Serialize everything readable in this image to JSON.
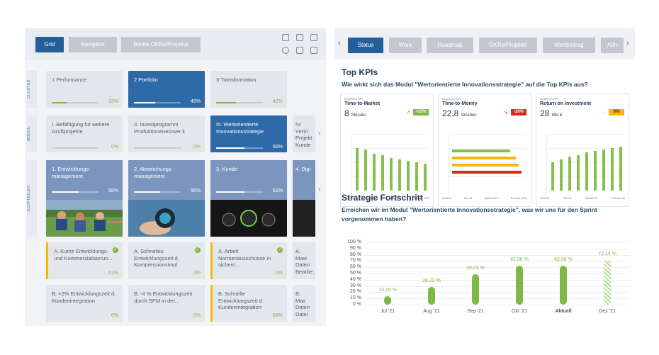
{
  "left": {
    "tabs": [
      "Grid",
      "Navigator",
      "Meine OKRs/Projekte"
    ],
    "side_labels": [
      "CLUSTER",
      "MODUL",
      "ECKPFEILER"
    ],
    "cluster": [
      {
        "title": "1 Performance",
        "pct": "33%",
        "progress": 0.33
      },
      {
        "title": "2 Portfolio",
        "pct": "45%",
        "progress": 0.45
      },
      {
        "title": "3 Transformation",
        "pct": "42%",
        "progress": 0.42
      }
    ],
    "modul": [
      {
        "title": "I. Befähigung für weitere Großprojekte",
        "pct": "0%",
        "progress": 0
      },
      {
        "title": "II. Investprogramm Produktionenetzwer k",
        "pct": "0%",
        "progress": 0
      },
      {
        "title": "III. Wertorientierte Innovationsstrategie",
        "pct": "60%",
        "progress": 0.6
      },
      {
        "title": "IV. Vertri Projekt Kunde"
      }
    ],
    "eckpfeiler": [
      {
        "title": "1. Entwicklungs- management",
        "pct": "58%",
        "progress": 0.58
      },
      {
        "title": "2. Abweichungs- management",
        "pct": "56%",
        "progress": 0.56
      },
      {
        "title": "3. Kunde",
        "pct": "61%",
        "progress": 0.61
      },
      {
        "title": "4. Digi"
      }
    ],
    "okr_row1": [
      {
        "title": "A. Kurze Entwicklungs- und Kommerzialisierun...",
        "pct": "61%"
      },
      {
        "title": "A. Schnelles Entwicklungszeit d. Kompressionsimul",
        "pct": "0%"
      },
      {
        "title": "A. Arbeit Normenausschüsse in sichern...",
        "pct": "0%"
      },
      {
        "title": "A. Maxi Daten Bearbe..."
      }
    ],
    "okr_row2": [
      {
        "title": "B. +2% Entwicklungszeit d. Kundenintegration",
        "pct": "0%"
      },
      {
        "title": "B. -4 % Entwicklungszeit durch SPM in der...",
        "pct": "0%"
      },
      {
        "title": "B. Schnelle Entwicklungszeit d. Kundenintegration",
        "pct": "68%"
      },
      {
        "title": "B. Max Daten Datei"
      }
    ]
  },
  "right": {
    "tabs": [
      "Status",
      "Work",
      "Roadmap",
      "OKRs/Projekte",
      "Wertbeitrag",
      "Abh"
    ],
    "top_kpis_title": "Top KPIs",
    "top_kpis_question": "Wie wirkt sich das Modul \"Wertorientierte Innovationsstrategie\" auf die Top KPIs aus?",
    "kpis": [
      {
        "small": "Ergebnis KPI",
        "name": "Time-to-Market",
        "value": "8",
        "unit": "Monate",
        "delta": "+33%",
        "delta_color": "#7fb842",
        "footer": [
          "Start 10",
          "Ziel 8",
          "Aktuell 8",
          "Erreicht 33%"
        ]
      },
      {
        "small": "Ergebnis KPI",
        "name": "Time-to-Money",
        "value": "22,8",
        "unit": "Wochen",
        "delta": "-20%",
        "delta_color": "#e02424",
        "footer": [
          "Start 24",
          "Ziel 18",
          "Aktuell 22,8",
          "Erreicht -20%"
        ]
      },
      {
        "small": "Ergebnis KPI",
        "name": "Return on Investment",
        "value": "28",
        "unit": "Mio €",
        "delta": "0%",
        "delta_color": "#f5b800",
        "footer": [
          "Start 24",
          "Ziel 30",
          "Aktuell 28",
          "Erreicht 0%"
        ]
      }
    ],
    "progress_title": "Strategie Fortschritt",
    "progress_question": "Erreichen wir im Modul \"Wertorientierte Innovationsstrategie\", was wir uns für den Sprint vorgenommen haben?",
    "chart_data": {
      "type": "bar",
      "title": "Strategie Fortschritt",
      "categories": [
        "Jul '21",
        "Aug '21",
        "Sep '21",
        "Okt '21",
        "Aktuell",
        "Dez '21"
      ],
      "values": [
        13.16,
        28.22,
        49.03,
        62.08,
        62.08,
        72.14
      ],
      "labels": [
        "13,16 %",
        "28,22 %",
        "49,03 %",
        "62,08 %",
        "62,08 %",
        "72,14 %"
      ],
      "y_ticks": [
        "0 %",
        "10 %",
        "20 %",
        "30 %",
        "40 %",
        "50 %",
        "60 %",
        "70 %",
        "80 %",
        "90 %",
        "100 %"
      ],
      "ylim": [
        0,
        100
      ]
    }
  }
}
